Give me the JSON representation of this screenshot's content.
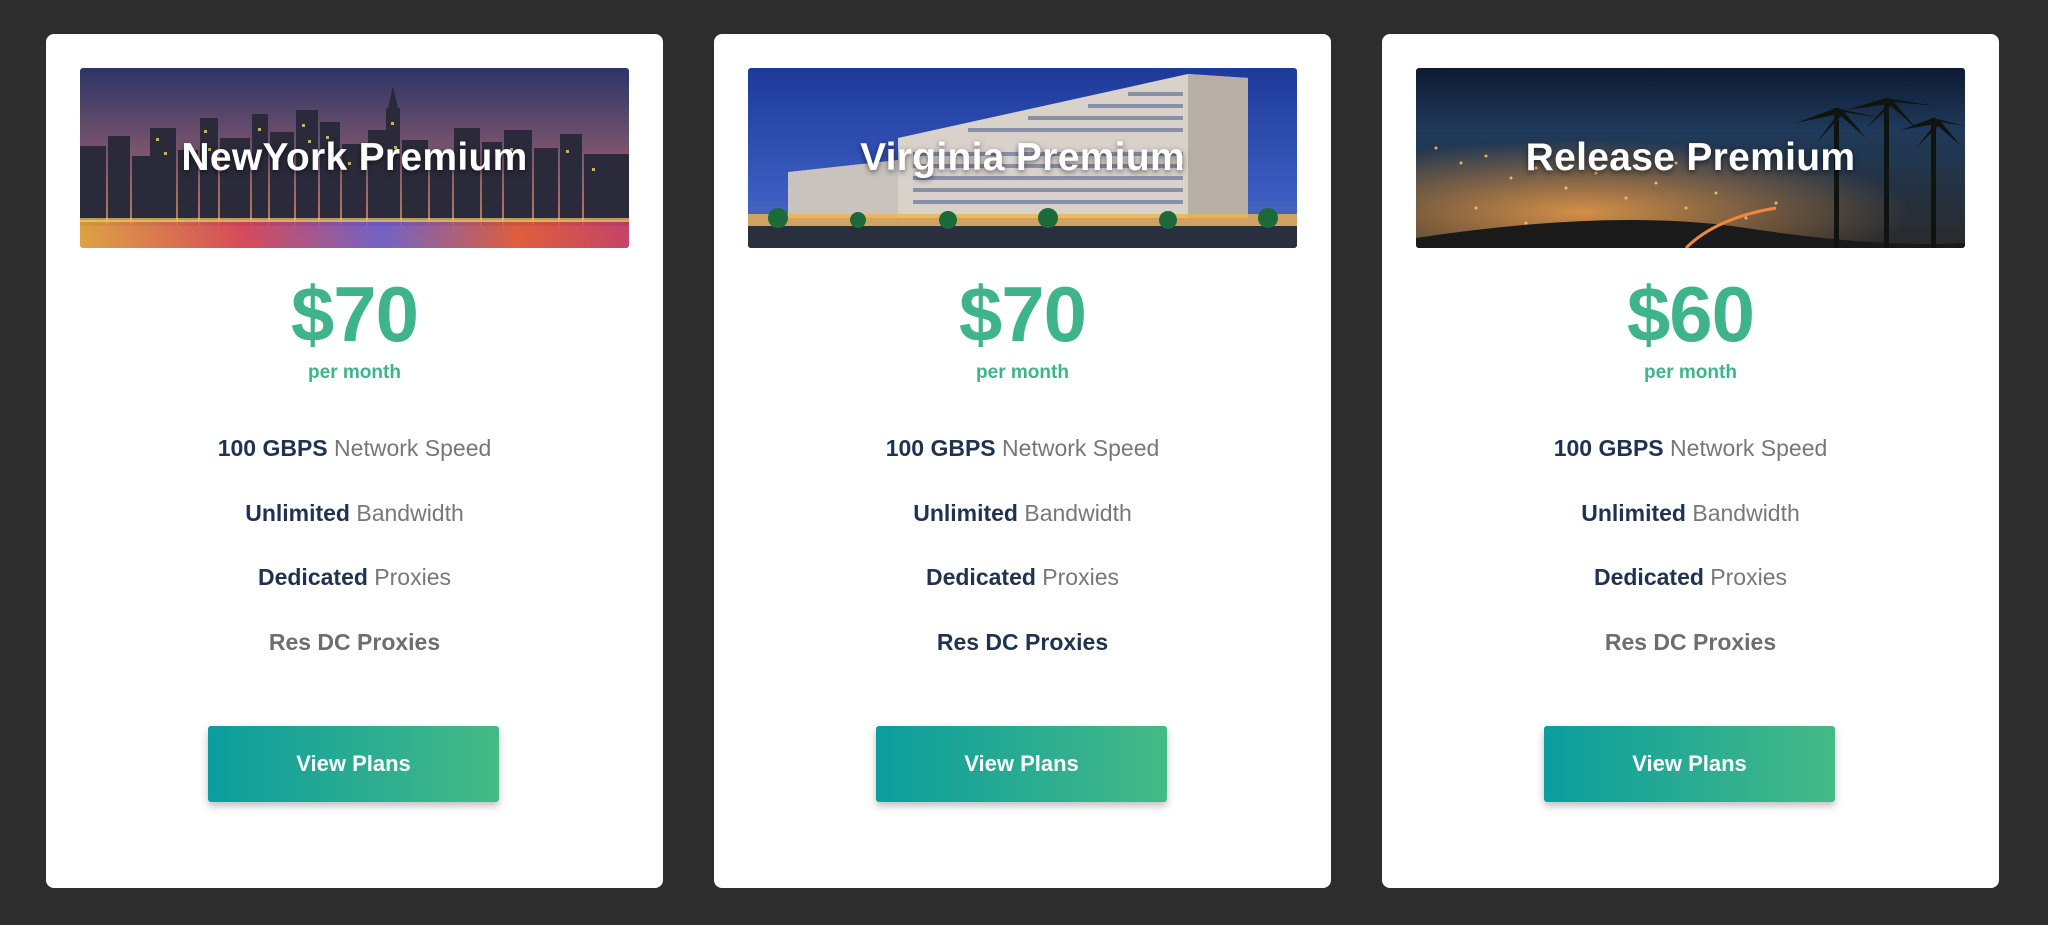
{
  "plans": [
    {
      "title": "NewYork Premium",
      "price": "$70",
      "period": "per month",
      "features": [
        {
          "bold": "100 GBPS",
          "rest": " Network Speed"
        },
        {
          "bold": "Unlimited",
          "rest": " Bandwidth"
        },
        {
          "bold": "Dedicated",
          "rest": " Proxies"
        },
        {
          "bold": "Res DC Proxies",
          "rest": ""
        }
      ],
      "button_label": "View Plans"
    },
    {
      "title": "Virginia Premium",
      "price": "$70",
      "period": "per month",
      "features": [
        {
          "bold": "100 GBPS",
          "rest": " Network Speed"
        },
        {
          "bold": "Unlimited",
          "rest": " Bandwidth"
        },
        {
          "bold": "Dedicated",
          "rest": " Proxies"
        },
        {
          "bold": "Res DC Proxies",
          "rest": ""
        }
      ],
      "button_label": "View Plans"
    },
    {
      "title": "Release Premium",
      "price": "$60",
      "period": "per month",
      "features": [
        {
          "bold": "100 GBPS",
          "rest": " Network Speed"
        },
        {
          "bold": "Unlimited",
          "rest": " Bandwidth"
        },
        {
          "bold": "Dedicated",
          "rest": " Proxies"
        },
        {
          "bold": "Res DC Proxies",
          "rest": ""
        }
      ],
      "button_label": "View Plans"
    }
  ],
  "colors": {
    "page_background": "#2d2d2d",
    "accent": "#3fb48a",
    "feature_strong": "#1f3350",
    "button_gradient_start": "#0b9d9e",
    "button_gradient_end": "#45ba86"
  }
}
